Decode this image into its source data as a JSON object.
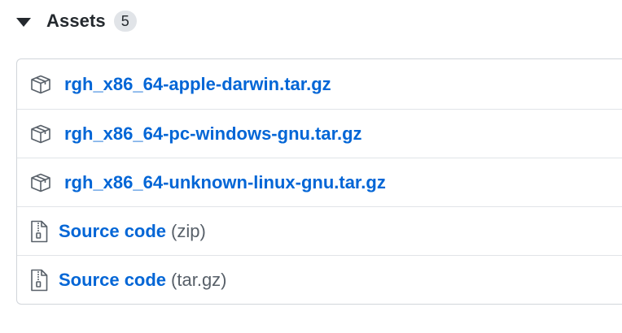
{
  "assets": {
    "title": "Assets",
    "count": "5",
    "files": [
      {
        "name": "rgh_x86_64-apple-darwin.tar.gz",
        "icon": "package-icon"
      },
      {
        "name": "rgh_x86_64-pc-windows-gnu.tar.gz",
        "icon": "package-icon"
      },
      {
        "name": "rgh_x86_64-unknown-linux-gnu.tar.gz",
        "icon": "package-icon"
      }
    ],
    "sources": [
      {
        "label": "Source code",
        "kind": "(zip)",
        "icon": "file-zip-icon"
      },
      {
        "label": "Source code",
        "kind": "(tar.gz)",
        "icon": "file-zip-icon"
      }
    ]
  },
  "colors": {
    "link": "#0366d6",
    "text": "#24292e",
    "muted": "#586069",
    "border": "#d1d5da",
    "badge_bg": "#e1e4e8"
  }
}
